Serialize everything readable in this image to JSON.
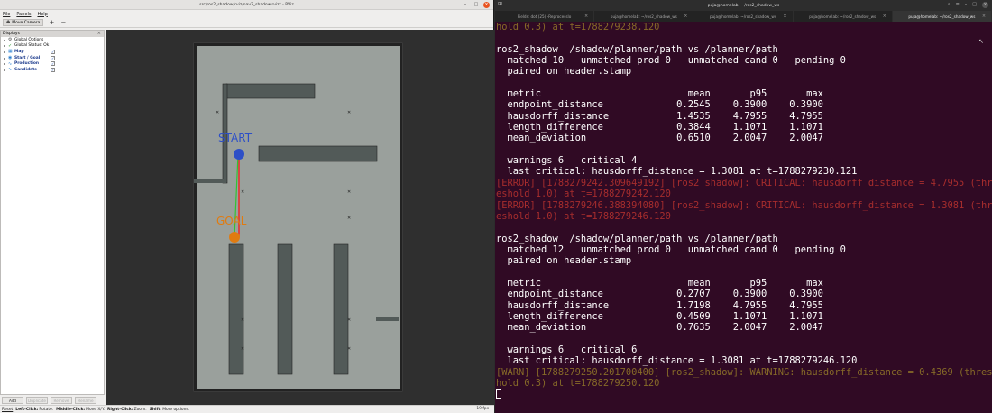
{
  "rviz": {
    "title": "src/ros2_shadow/rviz/nav2_shadow.rviz* - RViz",
    "menu": [
      "File",
      "Panels",
      "Help"
    ],
    "toolbar": {
      "move_camera": "Move Camera"
    },
    "displays": {
      "header": "Displays",
      "items": [
        {
          "label": "Global Options",
          "icon": "gear-icon",
          "checked": null
        },
        {
          "label": "Global Status: Ok",
          "icon": "check-icon",
          "checked": null
        },
        {
          "label": "Map",
          "icon": "map-icon",
          "checked": true
        },
        {
          "label": "Start / Goal",
          "icon": "marker-icon",
          "checked": true
        },
        {
          "label": "Production",
          "icon": "path-icon",
          "checked": true
        },
        {
          "label": "Candidate",
          "icon": "path-icon",
          "checked": true
        }
      ]
    },
    "panel_buttons": [
      "Add",
      "Duplicate",
      "Remove",
      "Rename"
    ],
    "status": {
      "reset": "Reset",
      "left_click_key": "Left-Click:",
      "left_click": "Rotate.",
      "middle_click_key": "Middle-Click:",
      "middle_click": "Move X/Y.",
      "right_click_key": "Right-Click:",
      "right_click": "Zoom.",
      "shift_key": "Shift:",
      "shift": "More options."
    },
    "fps": "19 fps",
    "map": {
      "start_label": "START",
      "goal_label": "GOAL",
      "start_color": "#2d4fc7",
      "goal_color": "#e07b10",
      "path_color": "#e83030",
      "candidate_color": "#33c233"
    }
  },
  "terminal": {
    "title": "puja@homelab: ~/ros2_shadow_ws",
    "tabs": [
      "Fields: dot (25) -Reprocesslo",
      "puja@homelab: ~/ros2_shadow_ws",
      "puja@homelab: ~/ros2_shadow_ws",
      "puja@homelab: ~/ros2_shadow_ws",
      "puja@homelab: ~/ros2_shadow_ws"
    ],
    "active_tab": 4,
    "lines": [
      {
        "t": "hold 0.3) at t=1788279238.120",
        "c": "warn"
      },
      {
        "t": "",
        "c": ""
      },
      {
        "t": "ros2_shadow  /shadow/planner/path vs /planner/path",
        "c": ""
      },
      {
        "t": "  matched 10   unmatched prod 0   unmatched cand 0   pending 0",
        "c": ""
      },
      {
        "t": "  paired on header.stamp",
        "c": ""
      },
      {
        "t": "",
        "c": ""
      },
      {
        "t": "  metric                          mean       p95       max",
        "c": ""
      },
      {
        "t": "  endpoint_distance             0.2545    0.3900    0.3900",
        "c": ""
      },
      {
        "t": "  hausdorff_distance            1.4535    4.7955    4.7955",
        "c": ""
      },
      {
        "t": "  length_difference             0.3844    1.1071    1.1071",
        "c": ""
      },
      {
        "t": "  mean_deviation                0.6510    2.0047    2.0047",
        "c": ""
      },
      {
        "t": "",
        "c": ""
      },
      {
        "t": "  warnings 6   critical 4",
        "c": ""
      },
      {
        "t": "  last critical: hausdorff_distance = 1.3081 at t=1788279230.121",
        "c": ""
      },
      {
        "t": "[ERROR] [1788279242.309649192] [ros2_shadow]: CRITICAL: hausdorff_distance = 4.7955 (thr",
        "c": "err"
      },
      {
        "t": "eshold 1.0) at t=1788279242.120",
        "c": "err"
      },
      {
        "t": "[ERROR] [1788279246.388394080] [ros2_shadow]: CRITICAL: hausdorff_distance = 1.3081 (thr",
        "c": "err"
      },
      {
        "t": "eshold 1.0) at t=1788279246.120",
        "c": "err"
      },
      {
        "t": "",
        "c": ""
      },
      {
        "t": "ros2_shadow  /shadow/planner/path vs /planner/path",
        "c": ""
      },
      {
        "t": "  matched 12   unmatched prod 0   unmatched cand 0   pending 0",
        "c": ""
      },
      {
        "t": "  paired on header.stamp",
        "c": ""
      },
      {
        "t": "",
        "c": ""
      },
      {
        "t": "  metric                          mean       p95       max",
        "c": ""
      },
      {
        "t": "  endpoint_distance             0.2707    0.3900    0.3900",
        "c": ""
      },
      {
        "t": "  hausdorff_distance            1.7198    4.7955    4.7955",
        "c": ""
      },
      {
        "t": "  length_difference             0.4509    1.1071    1.1071",
        "c": ""
      },
      {
        "t": "  mean_deviation                0.7635    2.0047    2.0047",
        "c": ""
      },
      {
        "t": "",
        "c": ""
      },
      {
        "t": "  warnings 6   critical 6",
        "c": ""
      },
      {
        "t": "  last critical: hausdorff_distance = 1.3081 at t=1788279246.120",
        "c": ""
      },
      {
        "t": "[WARN] [1788279250.201700400] [ros2_shadow]: WARNING: hausdorff_distance = 0.4369 (thres",
        "c": "warn"
      },
      {
        "t": "hold 0.3) at t=1788279250.120",
        "c": "warn"
      }
    ],
    "colors": {
      "background": "#300a24",
      "error": "#a62d2d",
      "warn": "#866a28"
    }
  }
}
